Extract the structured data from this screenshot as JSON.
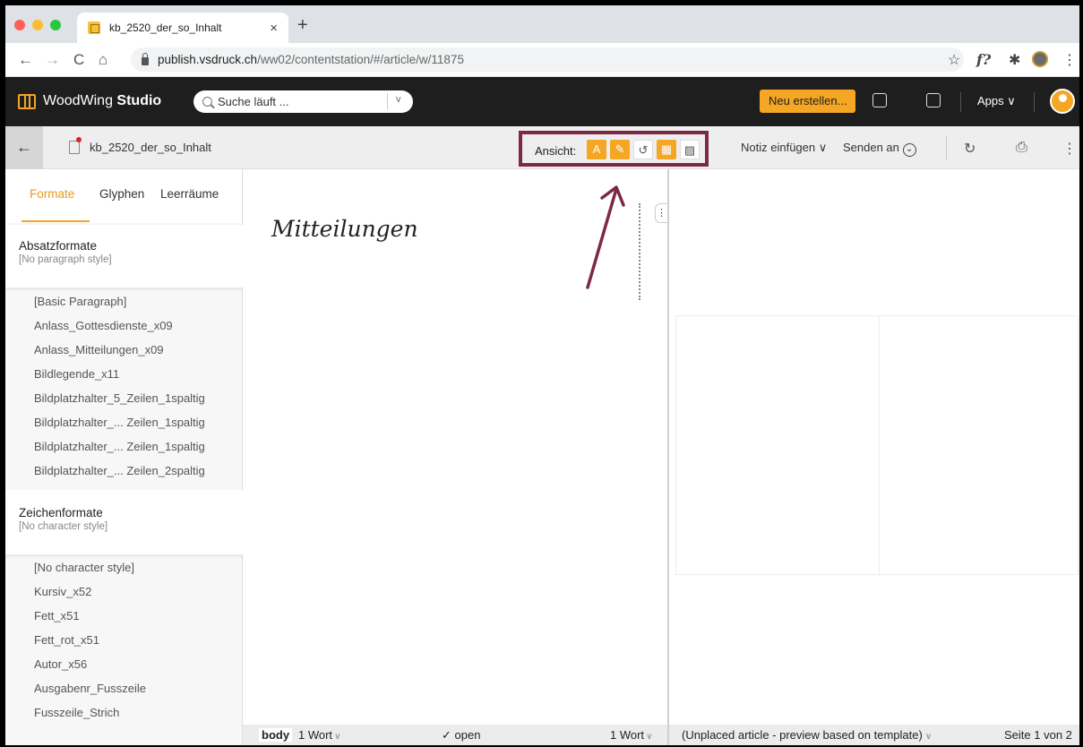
{
  "browser": {
    "tab_title": "kb_2520_der_so_Inhalt",
    "tab_close": "×",
    "new_tab": "+",
    "url_host": "publish.vsdruck.ch",
    "url_path": "/ww02/contentstation/#/article/w/11875",
    "back": "←",
    "forward": "→",
    "reload": "C",
    "home": "⌂",
    "star": "☆",
    "font_ext": "f?",
    "puzzle": "✱",
    "menu": "⋮",
    "traffic_colors": [
      "#ff5f57",
      "#febc2e",
      "#28c840"
    ]
  },
  "header": {
    "brand_light": "WoodWing",
    "brand_bold": "Studio",
    "search_value": "Suche läuft ...",
    "search_chevron": "v",
    "new_button": "Neu erstellen...",
    "apps_label": "Apps",
    "apps_chevron": "∨",
    "accent": "#f5a623"
  },
  "toolbar": {
    "back": "←",
    "article_name": "kb_2520_der_so_Inhalt",
    "view_label": "Ansicht:",
    "view_buttons": [
      "A",
      "✎",
      "↺",
      "▦",
      "▨"
    ],
    "insert_note": "Notiz einfügen ∨",
    "send_to": "Senden an",
    "send_chevron": "⌄",
    "refresh": "↻",
    "pdf": "⎙",
    "more": "⋮",
    "highlight_color": "#7d2845"
  },
  "panel": {
    "tabs": [
      "Formate",
      "Glyphen",
      "Leerräume"
    ],
    "paragraph": {
      "title": "Absatzformate",
      "current": "[No paragraph style]",
      "items": [
        "[Basic Paragraph]",
        "Anlass_Gottesdienste_x09",
        "Anlass_Mitteilungen_x09",
        "Bildlegende_x11",
        "Bildplatzhalter_5_Zeilen_1spaltig",
        "Bildplatzhalter_... Zeilen_1spaltig",
        "Bildplatzhalter_... Zeilen_1spaltig",
        "Bildplatzhalter_... Zeilen_2spaltig"
      ]
    },
    "character": {
      "title": "Zeichenformate",
      "current": "[No character style]",
      "items": [
        "[No character style]",
        "Kursiv_x52",
        "Fett_x51",
        "Fett_rot_x51",
        "Autor_x56",
        "Ausgabenr_Fusszeile",
        "Fusszeile_Strich"
      ]
    }
  },
  "editor": {
    "headline": "Mitteilungen",
    "handle": "⋮"
  },
  "status": {
    "style_tag": "body",
    "word_count_left": "1 Wort",
    "open_state": "✓ open",
    "word_count_right": "1 Wort",
    "chev": "∨",
    "preview_note": "(Unplaced article - preview based on template)",
    "page_info": "Seite 1 von 2"
  }
}
